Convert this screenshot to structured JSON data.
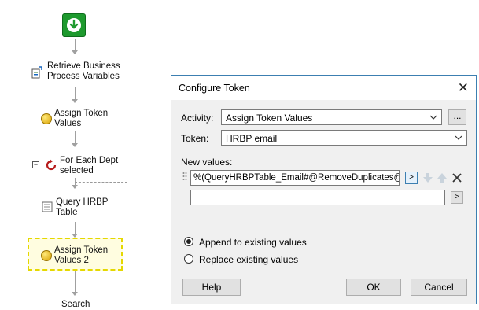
{
  "workflow": {
    "nodes": [
      {
        "label": "Retrieve Business Process Variables",
        "icon": "variables-icon"
      },
      {
        "label": "Assign Token Values",
        "icon": "coin-icon"
      },
      {
        "label": "For Each Dept selected",
        "icon": "loop-icon"
      },
      {
        "label": "Query HRBP Table",
        "icon": "query-icon"
      },
      {
        "label": "Assign Token Values 2",
        "icon": "coin-icon",
        "selected": true
      },
      {
        "label": "Search",
        "icon": "search-icon"
      }
    ]
  },
  "dialog": {
    "title": "Configure Token",
    "activity_label": "Activity:",
    "activity_value": "Assign Token Values",
    "activity_browse": "...",
    "token_label": "Token:",
    "token_value": "HRBP email",
    "new_values_label": "New values:",
    "value_1": "%(QueryHRBPTable_Email#@RemoveDuplicates@#)",
    "value_2": "",
    "insert_label": ">",
    "radio_append": "Append to existing values",
    "radio_replace": "Replace existing values",
    "append_selected": true,
    "help_label": "Help",
    "ok_label": "OK",
    "cancel_label": "Cancel"
  },
  "colors": {
    "start_green": "#1e9a2e",
    "dialog_border": "#3c7fb1",
    "selection_yellow": "#e5d800"
  }
}
